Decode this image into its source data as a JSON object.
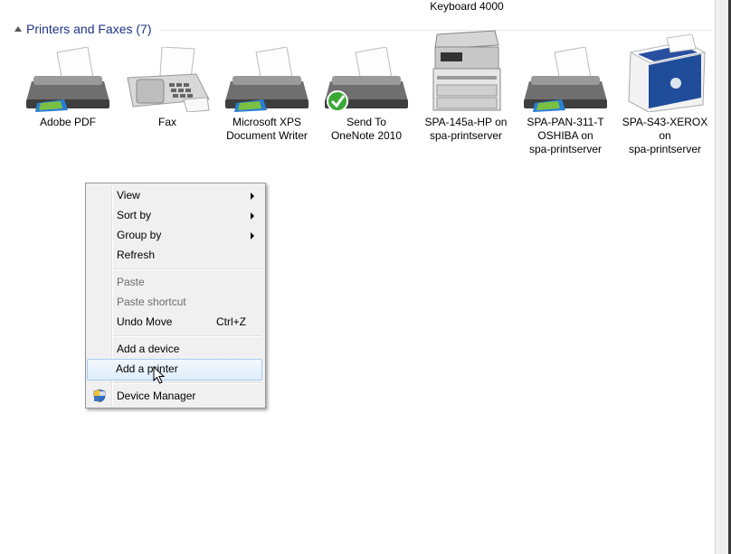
{
  "top_caption": "Keyboard 4000",
  "group": {
    "title": "Printers and Faxes (7)"
  },
  "devices": [
    {
      "label": "Adobe PDF",
      "icon": "printer-icon"
    },
    {
      "label": "Fax",
      "icon": "fax-icon"
    },
    {
      "label": "Microsoft XPS\nDocument Writer",
      "icon": "printer-icon"
    },
    {
      "label": "Send To\nOneNote 2010",
      "icon": "printer-default-icon"
    },
    {
      "label": "SPA-145a-HP on\nspa-printserver",
      "icon": "multifunction-printer-icon"
    },
    {
      "label": "SPA-PAN-311-T\nOSHIBA on\nspa-printserver",
      "icon": "printer-icon"
    },
    {
      "label": "SPA-S43-XEROX\non\nspa-printserver",
      "icon": "xerox-printer-icon"
    }
  ],
  "context_menu": {
    "view": "View",
    "sort_by": "Sort by",
    "group_by": "Group by",
    "refresh": "Refresh",
    "paste": "Paste",
    "paste_shortcut": "Paste shortcut",
    "undo_move": "Undo Move",
    "undo_move_shortcut": "Ctrl+Z",
    "add_device": "Add a device",
    "add_printer": "Add a printer",
    "device_manager": "Device Manager"
  },
  "colors": {
    "group_title": "#1e3287",
    "menu_bg": "#f0f0f0",
    "highlight_border": "#a8cbf0"
  }
}
